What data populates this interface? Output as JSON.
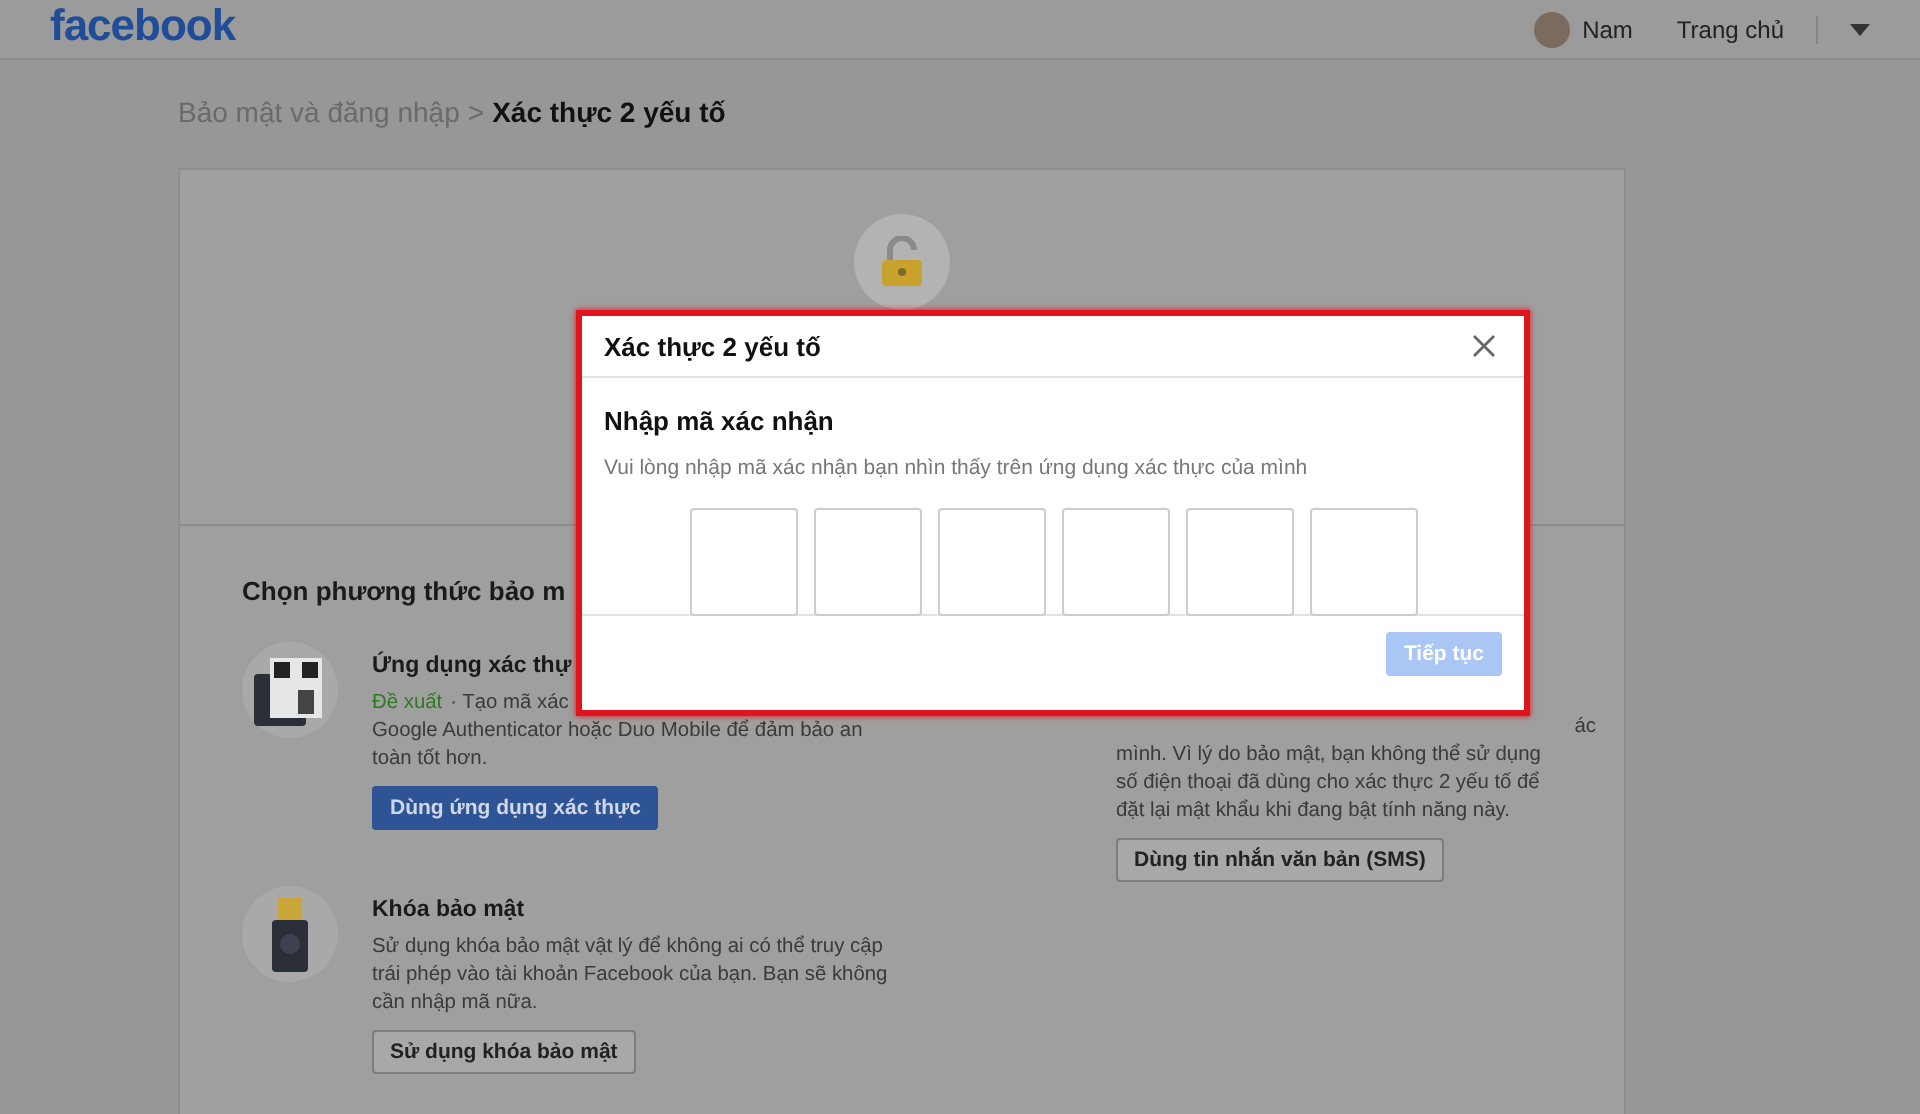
{
  "header": {
    "logo": "facebook",
    "user": "Nam",
    "home": "Trang chủ"
  },
  "breadcrumb": {
    "parent": "Bảo mật và đăng nhập",
    "separator": ">",
    "current": "Xác thực 2 yếu tố"
  },
  "methods": {
    "heading": "Chọn phương thức bảo m",
    "items": [
      {
        "kind": "app",
        "title": "Ứng dụng xác thự",
        "recommended": "Đề xuất",
        "lines": [
          "· Tạo mã xác",
          "Google Authenticator hoặc Duo Mobile để đảm bảo an",
          "toàn tốt hơn."
        ],
        "button": "Dùng ứng dụng xác thực",
        "primary": true
      },
      {
        "kind": "key",
        "title": "Khóa bảo mật",
        "lines": [
          "Sử dụng khóa bảo mật vật lý để không ai có thể truy cập",
          "trái phép vào tài khoản Facebook của bạn. Bạn sẽ không",
          "cần nhập mã nữa."
        ],
        "button": "Sử dụng khóa bảo mật",
        "primary": false
      }
    ],
    "sms": {
      "lines": [
        "ác",
        "mình. Vì lý do bảo mật, bạn không thể sử dụng",
        "số điện thoại đã dùng cho xác thực 2 yếu tố để",
        "đặt lại mật khẩu khi đang bật tính năng này."
      ],
      "button": "Dùng tin nhắn văn bản (SMS)"
    }
  },
  "dialog": {
    "title": "Xác thực 2 yếu tố",
    "heading": "Nhập mã xác nhận",
    "hint": "Vui lòng nhập mã xác nhận bạn nhìn thấy trên ứng dụng xác thực của mình",
    "code_digits": [
      {
        "filled": false
      },
      {
        "filled": false
      },
      {
        "filled": false
      },
      {
        "filled": false
      },
      {
        "filled": false
      },
      {
        "filled": false
      }
    ],
    "button": {
      "label": "Tiếp tục",
      "disabled": true
    }
  }
}
